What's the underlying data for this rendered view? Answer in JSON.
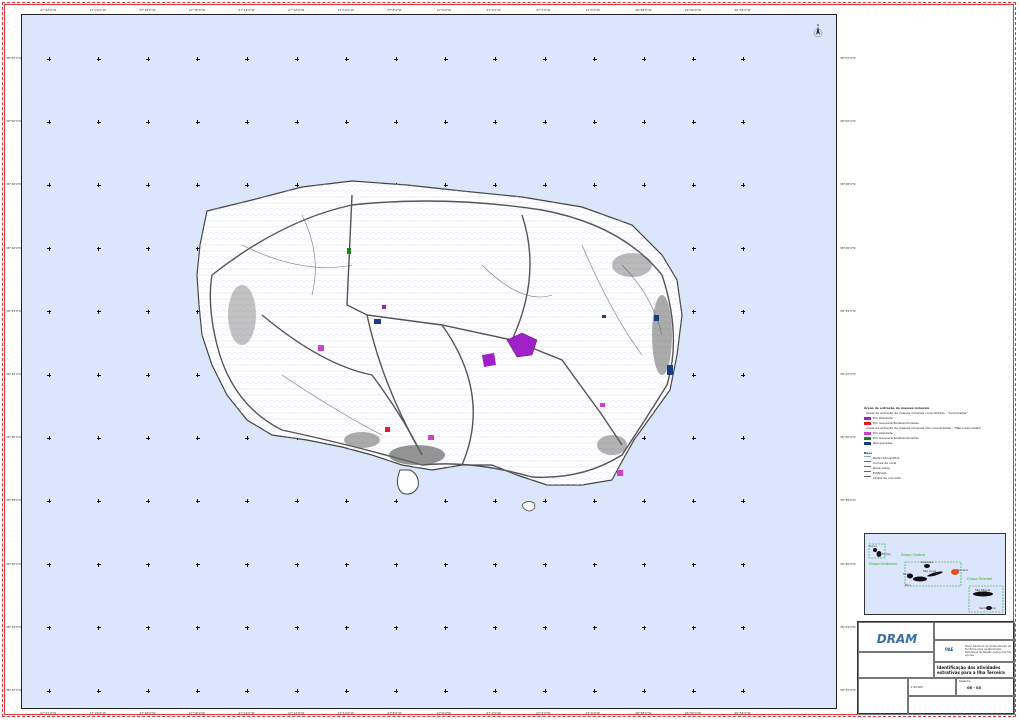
{
  "map": {
    "island": "Terceira",
    "north_label": "N",
    "grid_lon_labels": [
      "27°22'0\"W",
      "27°20'0\"W",
      "27°18'0\"W",
      "27°16'0\"W",
      "27°14'0\"W",
      "27°12'0\"W",
      "27°10'0\"W",
      "27°8'0\"W",
      "27°6'0\"W",
      "27°4'0\"W",
      "27°2'0\"W",
      "27°0'0\"W",
      "26°58'0\"W",
      "26°56'0\"W",
      "26°54'0\"W"
    ],
    "grid_lat_labels": [
      "38°52'0\"N",
      "38°50'0\"N",
      "38°48'0\"N",
      "38°46'0\"N",
      "38°44'0\"N",
      "38°42'0\"N",
      "38°40'0\"N",
      "38°38'0\"N",
      "38°36'0\"N",
      "38°34'0\"N",
      "38°32'0\"N"
    ]
  },
  "legend": {
    "title": "Áreas de extração de massas minerais",
    "items": [
      {
        "label": "Áreas de extração de massas minerais consolidadas - \"Licenciadas\"",
        "color": "#ffffff"
      },
      {
        "label": "Em atividade",
        "color": "#a020c8"
      },
      {
        "label": "Em recuperação/abandonadas",
        "color": "#e02020"
      },
      {
        "label": "Áreas de extração de massas minerais não consolidadas - \"Não Licenciadas\"",
        "color": "#ffffff"
      },
      {
        "label": "Em atividade",
        "color": "#d040d0"
      },
      {
        "label": "Em recuperação/abandonadas",
        "color": "#208020"
      },
      {
        "label": "Recuperadas",
        "color": "#1a3a8a"
      }
    ],
    "base_title": "Base",
    "base_items": [
      "Rede hidrográfica",
      "Curvas de nível",
      "Rede viária",
      "Edificado",
      "Limite de concelho"
    ]
  },
  "inset": {
    "groups": [
      "Grupo Ocidental",
      "Grupo Central",
      "Grupo Oriental"
    ],
    "islands": [
      "Corvo",
      "Flores",
      "Graciosa",
      "São Jorge",
      "Terceira",
      "Pico",
      "Faial",
      "São Miguel",
      "Santa Maria"
    ]
  },
  "titleblock": {
    "org": "PAE",
    "title": "Identificação das atividades extrativas para a Ilha Terceira",
    "subtitle": "Plano Sectorial de Ordenamento do Território para as Atividades Extrativas da Região Autónoma dos Açores",
    "scale": "1:50 000",
    "sheet": "Desenho",
    "drawing_no": "06 - 03"
  },
  "colors": {
    "sea": "#dbe5fb",
    "land": "#ffffff",
    "roads": "#555555",
    "frame": "#e0373b",
    "hydro": "#a8b8e8"
  }
}
